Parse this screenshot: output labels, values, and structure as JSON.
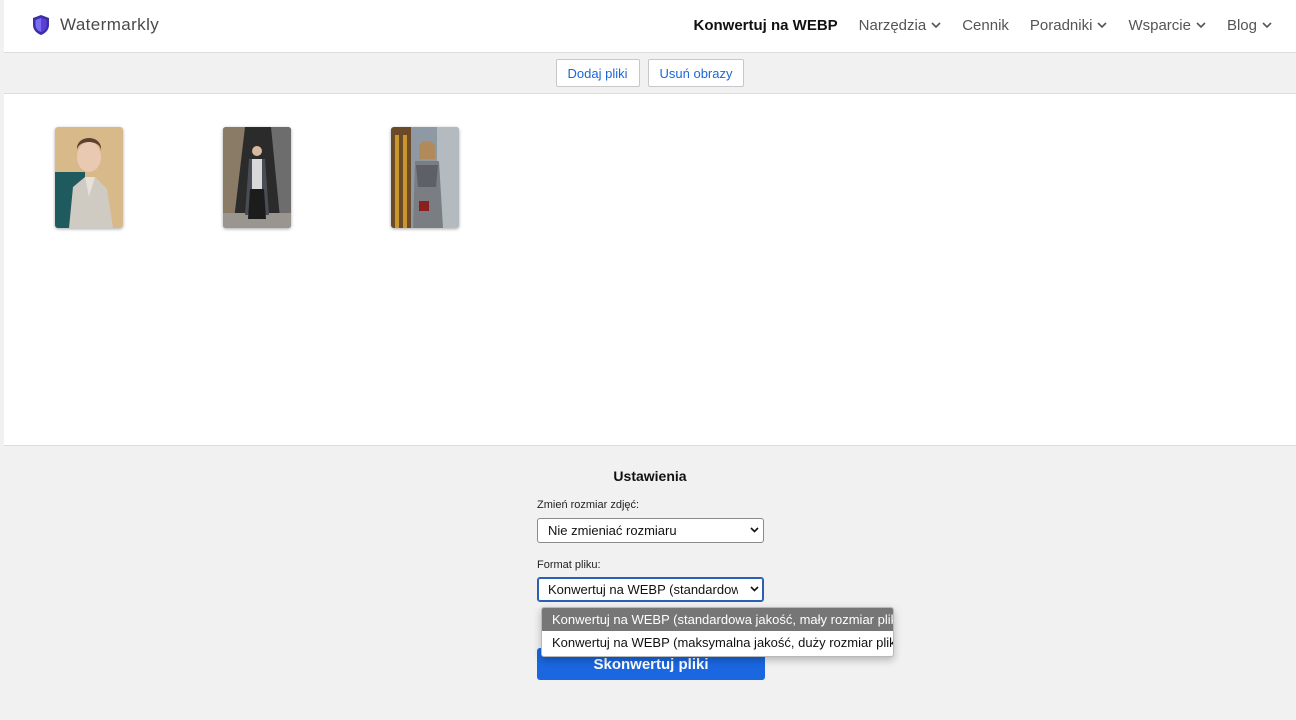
{
  "header": {
    "brand": "Watermarkly",
    "nav": [
      {
        "label": "Konwertuj na WEBP",
        "active": true,
        "dropdown": false
      },
      {
        "label": "Narzędzia",
        "active": false,
        "dropdown": true
      },
      {
        "label": "Cennik",
        "active": false,
        "dropdown": false
      },
      {
        "label": "Poradniki",
        "active": false,
        "dropdown": true
      },
      {
        "label": "Wsparcie",
        "active": false,
        "dropdown": true
      },
      {
        "label": "Blog",
        "active": false,
        "dropdown": true
      }
    ]
  },
  "toolbar": {
    "add_files": "Dodaj pliki",
    "remove_images": "Usuń obrazy"
  },
  "gallery": {
    "images": [
      {
        "icon": "portrait-photo"
      },
      {
        "icon": "street-fashion-photo"
      },
      {
        "icon": "city-street-photo"
      }
    ]
  },
  "settings": {
    "title": "Ustawienia",
    "resize_label": "Zmień rozmiar zdjęć:",
    "resize_value": "Nie zmieniać rozmiaru",
    "format_label": "Format pliku:",
    "format_value": "Konwertuj na WEBP (standardowa jakość, mały rozmiar pliku)",
    "format_options": [
      {
        "label": "Konwertuj na WEBP (standardowa jakość, mały rozmiar pliku)",
        "selected": true
      },
      {
        "label": "Konwertuj na WEBP (maksymalna jakość, duży rozmiar pliku)",
        "selected": false
      }
    ],
    "convert_button": "Skonwertuj pliki"
  },
  "colors": {
    "accent": "#1a67e0",
    "link": "#1a68d6",
    "shield": "#5b3fd6"
  }
}
